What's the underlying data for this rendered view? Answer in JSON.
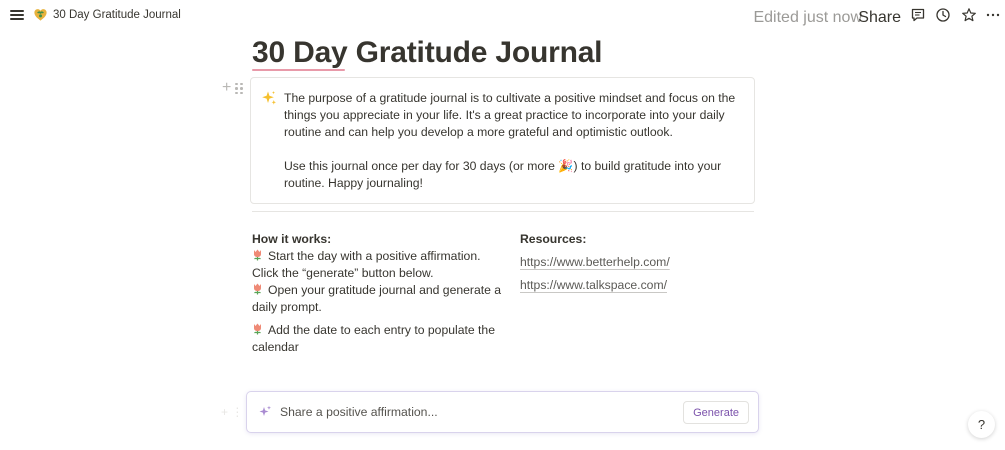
{
  "topbar": {
    "breadcrumb": "30 Day Gratitude Journal",
    "edited": "Edited just now",
    "share": "Share",
    "icons": [
      "menu-icon",
      "comment-icon",
      "history-icon",
      "star-icon"
    ]
  },
  "page": {
    "title": "30 Day Gratitude Journal",
    "callout_icon": "sparkles-icon",
    "callout_p1": "The purpose of a gratitude journal is to cultivate a positive mindset and focus on the things you appreciate in your life. It's a great practice to incorporate into your daily routine and can help you develop a more grateful and optimistic outlook.",
    "callout_p2": "Use this journal once per day for 30 days (or more 🎉) to build gratitude into your routine. Happy journaling!"
  },
  "how_it_works": {
    "heading": "How it works:",
    "steps": [
      "Start the day with a positive affirmation. Click the “generate” button below.",
      "Open your gratitude journal and generate a daily prompt.",
      "Add the date to each entry to populate the calendar"
    ]
  },
  "resources": {
    "heading": "Resources:",
    "links": [
      "https://www.betterhelp.com/",
      "https://www.talkspace.com/"
    ]
  },
  "ai_bar": {
    "placeholder": "Share a positive affirmation...",
    "button": "Generate"
  },
  "help": {
    "label": "?"
  },
  "colors": {
    "accent": "#7b52ab",
    "underline": "#e89aa9",
    "text": "#37352f",
    "muted": "#9b9a97"
  }
}
